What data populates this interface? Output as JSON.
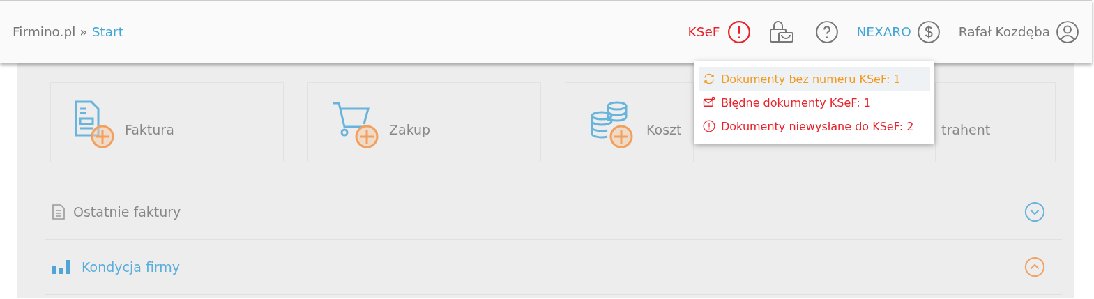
{
  "breadcrumb": {
    "root": "Firmino.pl",
    "separator": "»",
    "current": "Start"
  },
  "header": {
    "ksef_label": "KSeF",
    "partner": "NEXARO",
    "user": "Rafał Kozdęba"
  },
  "ksef_menu": [
    {
      "kind": "sync",
      "label": "Dokumenty bez numeru KSeF: 1",
      "color": "#f39a1e",
      "selected": true
    },
    {
      "kind": "mail",
      "label": "Błędne dokumenty KSeF: 1",
      "color": "#e8232a",
      "selected": false
    },
    {
      "kind": "alert",
      "label": "Dokumenty niewysłane do KSeF: 2",
      "color": "#e8232a",
      "selected": false
    }
  ],
  "tiles": [
    {
      "kind": "invoice",
      "label": "Faktura"
    },
    {
      "kind": "cart",
      "label": "Zakup"
    },
    {
      "kind": "coins",
      "label": "Koszt"
    },
    {
      "kind": "hidden",
      "label": "trahent"
    }
  ],
  "sections": [
    {
      "kind": "document",
      "title": "Ostatnie faktury",
      "expanded": false
    },
    {
      "kind": "chart",
      "title": "Kondycja firmy",
      "expanded": true
    }
  ]
}
